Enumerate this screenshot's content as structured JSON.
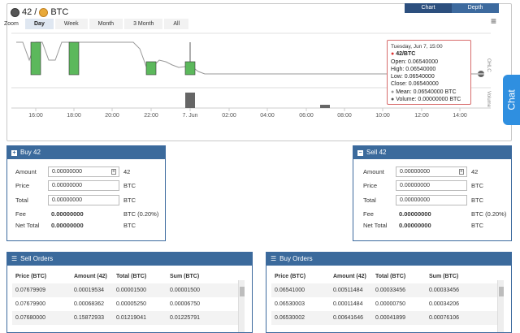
{
  "header": {
    "base": "42",
    "separator": "/",
    "quote": "BTC"
  },
  "chart_tabs": [
    "Chart",
    "Depth"
  ],
  "zoom": {
    "label": "Zoom",
    "options": [
      "Day",
      "Week",
      "Month",
      "3 Month",
      "All"
    ],
    "selected": "Day"
  },
  "chart_data": {
    "type": "candlestick",
    "x_ticks": [
      "16:00",
      "18:00",
      "20:00",
      "22:00",
      "7. Jun",
      "02:00",
      "04:00",
      "06:00",
      "08:00",
      "10:00",
      "12:00",
      "14:00"
    ],
    "right_axis_labels": [
      "OHLC",
      "Volume"
    ],
    "colors": {
      "up": "#5cb85c",
      "down": "#5cb85c",
      "line": "#999999"
    }
  },
  "tooltip": {
    "date": "Tuesday, Jun 7, 15:00",
    "pair": "42/BTC",
    "open": "Open: 0.06540000",
    "high": "High: 0.06540000",
    "low": "Low: 0.06540000",
    "close": "Close: 0.06540000",
    "mean": "Mean: 0.06540000 BTC",
    "volume": "Volume: 0.00000000 BTC"
  },
  "chat_label": "Chat",
  "buy": {
    "title": "Buy 42",
    "amount_label": "Amount",
    "amount_value": "0.00000000",
    "amount_unit": "42",
    "price_label": "Price",
    "price_value": "0.00000000",
    "price_unit": "BTC",
    "total_label": "Total",
    "total_value": "0.00000000",
    "total_unit": "BTC",
    "fee_label": "Fee",
    "fee_value": "0.00000000",
    "fee_unit": "BTC (0.20%)",
    "net_label": "Net Total",
    "net_value": "0.00000000",
    "net_unit": "BTC"
  },
  "sell": {
    "title": "Sell 42",
    "amount_label": "Amount",
    "amount_value": "0.00000000",
    "amount_unit": "42",
    "price_label": "Price",
    "price_value": "0.00000000",
    "price_unit": "BTC",
    "total_label": "Total",
    "total_value": "0.00000000",
    "total_unit": "BTC",
    "fee_label": "Fee",
    "fee_value": "0.00000000",
    "fee_unit": "BTC (0.20%)",
    "net_label": "Net Total",
    "net_value": "0.00000000",
    "net_unit": "BTC"
  },
  "sell_orders": {
    "title": "Sell Orders",
    "columns": [
      "Price (BTC)",
      "Amount (42)",
      "Total (BTC)",
      "Sum (BTC)"
    ],
    "rows": [
      [
        "0.07679909",
        "0.00019534",
        "0.00001500",
        "0.00001500"
      ],
      [
        "0.07679900",
        "0.00068362",
        "0.00005250",
        "0.00006750"
      ],
      [
        "0.07680000",
        "0.15872933",
        "0.01219041",
        "0.01225791"
      ]
    ]
  },
  "buy_orders": {
    "title": "Buy Orders",
    "columns": [
      "Price (BTC)",
      "Amount (42)",
      "Total (BTC)",
      "Sum (BTC)"
    ],
    "rows": [
      [
        "0.06541000",
        "0.00511484",
        "0.00033456",
        "0.00033456"
      ],
      [
        "0.06530003",
        "0.00011484",
        "0.00000750",
        "0.00034206"
      ],
      [
        "0.06530002",
        "0.00641646",
        "0.00041899",
        "0.00076106"
      ]
    ]
  }
}
